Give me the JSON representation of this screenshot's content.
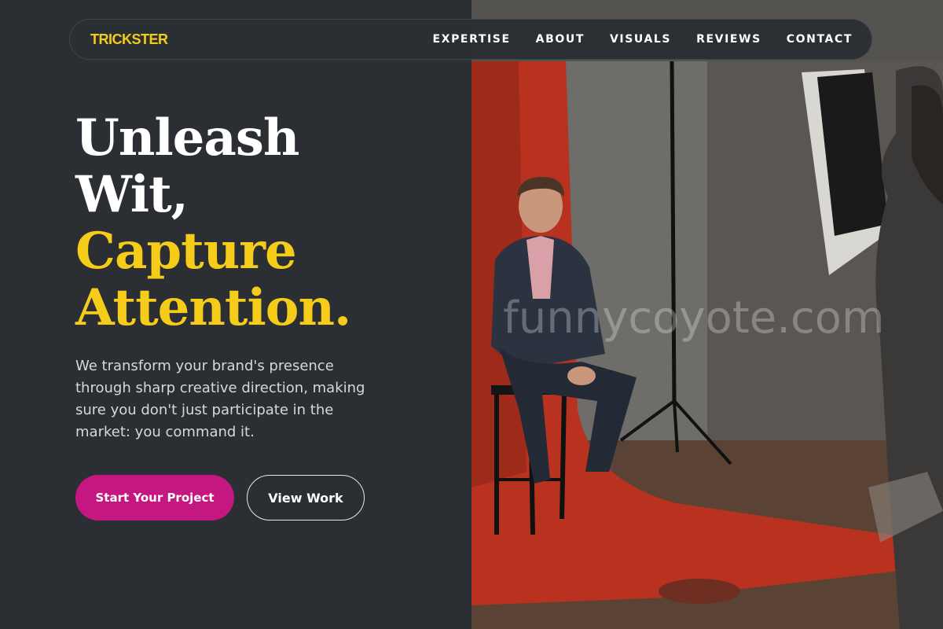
{
  "nav": {
    "brand": "TRICKSTER",
    "links": [
      "EXPERTISE",
      "ABOUT",
      "VISUALS",
      "REVIEWS",
      "CONTACT"
    ]
  },
  "hero": {
    "headline_white_1": "Unleash",
    "headline_white_2": "Wit,",
    "headline_yellow_1": "Capture",
    "headline_yellow_2": "Attention.",
    "subtext": "We transform your brand's presence through sharp creative direction, making sure you don't just participate in the market: you command it.",
    "primary_button": "Start Your Project",
    "secondary_button": "View Work"
  },
  "watermark": "funnycoyote.com",
  "colors": {
    "background": "#2b2f33",
    "accent_yellow": "#f5cc1a",
    "accent_magenta": "#c4177f",
    "backdrop_red": "#b8321f"
  }
}
